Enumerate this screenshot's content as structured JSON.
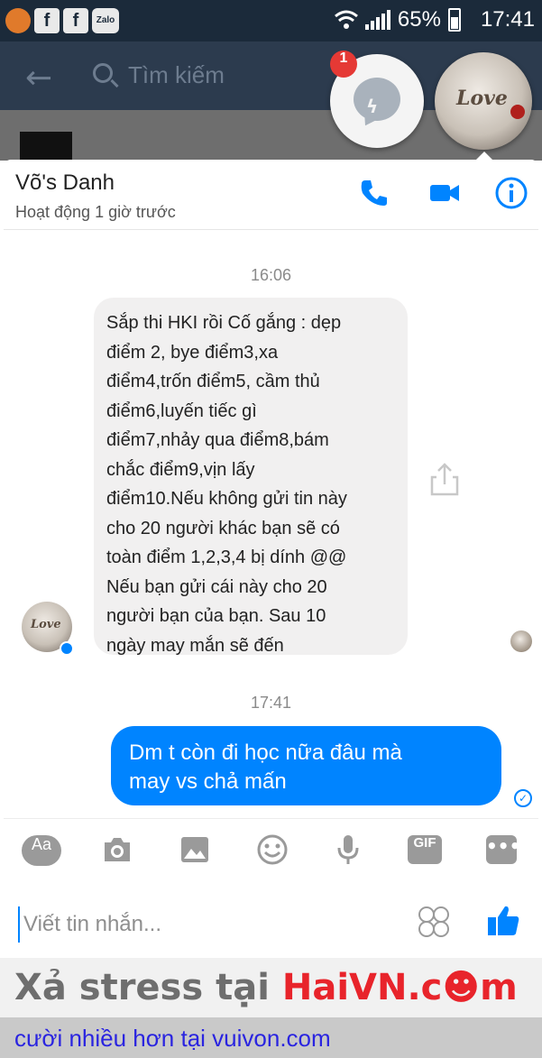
{
  "status_bar": {
    "apps": [
      "f",
      "f"
    ],
    "zalo_label": "Zalo",
    "battery": "65%",
    "time": "17:41"
  },
  "background_header": {
    "search_placeholder": "Tìm kiếm"
  },
  "chat_heads": {
    "messenger_badge": "1",
    "avatar_text": "Love"
  },
  "conversation": {
    "contact_name": "Võ's Danh",
    "status": "Hoạt động 1 giờ trước",
    "timestamp_1": "16:06",
    "incoming_message": "Sắp thi HKI rồi Cố gắng : dẹp\nđiểm 2, bye điểm3,xa\nđiểm4,trốn điểm5, cầm thủ\nđiểm6,luyến tiếc gì\nđiểm7,nhảy qua điểm8,bám\nchắc điểm9,vịn lấy\nđiểm10.Nếu không gửi tin này\ncho 20 người khác bạn sẽ có\ntoàn điểm 1,2,3,4 bị dính @@\nNếu bạn gửi cái này cho 20\nngười bạn của bạn. Sau 10\nngày may mắn sẽ đến",
    "timestamp_2": "17:41",
    "outgoing_message": "Dm  t còn  đi học nữa  đâu mà\nmay vs chả mấn"
  },
  "toolbar": {
    "aa_label": "Aa",
    "gif_label": "GIF",
    "more_label": "•••"
  },
  "composer": {
    "placeholder": "Viết tin nhắn..."
  },
  "watermark": {
    "prefix": "Xả stress tại ",
    "brand": "HaiVN.c☻m"
  },
  "footer": {
    "text": "cười nhiều hơn tại vuivon.com"
  },
  "colors": {
    "accent": "#0084ff",
    "status_bar": "#1b2a3a",
    "watermark_brand": "#e8242b",
    "footer_link": "#2a24e0"
  }
}
